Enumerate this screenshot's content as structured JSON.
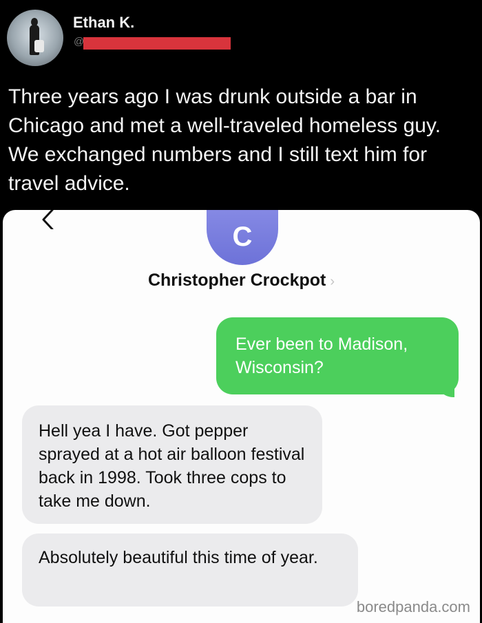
{
  "tweet": {
    "author_name": "Ethan K.",
    "handle_prefix": "@",
    "text": "Three years ago I was drunk outside a bar in Chicago and met a well-traveled homeless guy. We exchanged numbers and I still text him for travel advice."
  },
  "messages_app": {
    "back_icon": "chevron-left-icon",
    "contact_initial": "C",
    "contact_name": "Christopher Crockpot",
    "contact_chevron": "›",
    "messages": [
      {
        "direction": "outgoing",
        "text": "Ever been to Madison, Wisconsin?"
      },
      {
        "direction": "incoming",
        "text": "Hell yea I have. Got pepper sprayed at a hot air balloon festival back in 1998. Took three cops to take me down."
      },
      {
        "direction": "incoming",
        "text": "Absolutely beautiful this time of year."
      }
    ]
  },
  "watermark": "boredpanda.com",
  "colors": {
    "background": "#000000",
    "outgoing_bubble": "#4ccf5c",
    "incoming_bubble": "#ebebed",
    "contact_avatar": "#7a7fe0",
    "redaction": "#d8343c"
  }
}
